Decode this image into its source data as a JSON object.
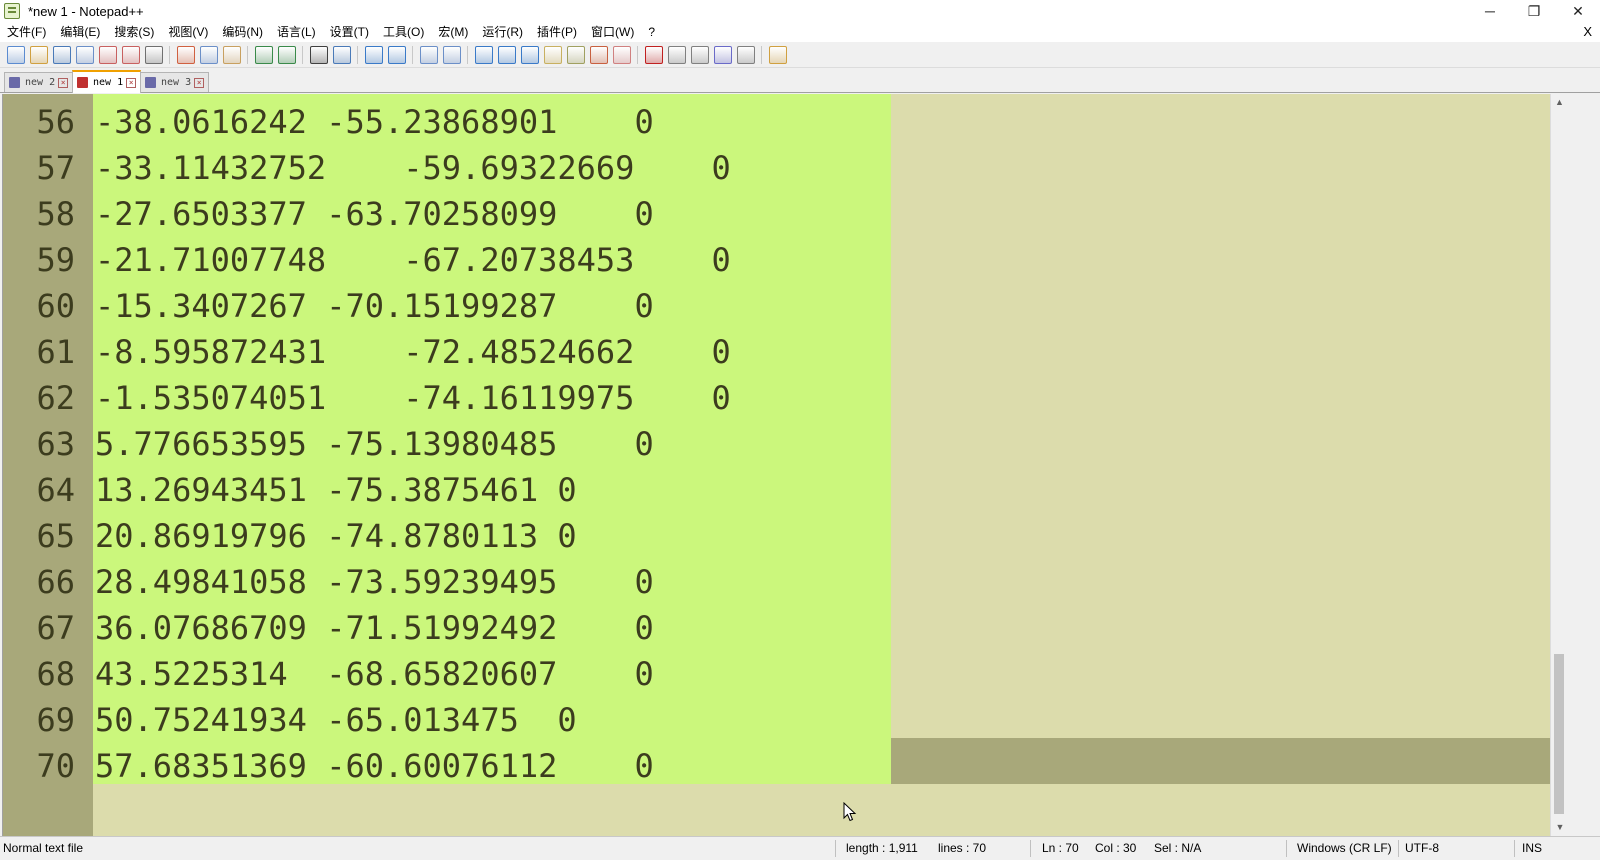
{
  "window": {
    "title": "*new 1 - Notepad++",
    "minimize_glyph": "─",
    "restore_glyph": "❐",
    "close_glyph": "✕"
  },
  "menu": {
    "items": [
      "文件(F)",
      "编辑(E)",
      "搜索(S)",
      "视图(V)",
      "编码(N)",
      "语言(L)",
      "设置(T)",
      "工具(O)",
      "宏(M)",
      "运行(R)",
      "插件(P)",
      "窗口(W)",
      "?"
    ],
    "close_label": "X"
  },
  "toolbar": {
    "icons": [
      "new-file-icon",
      "open-file-icon",
      "save-icon",
      "save-all-icon",
      "close-icon",
      "close-all-icon",
      "print-icon",
      "cut-icon",
      "copy-icon",
      "paste-icon",
      "undo-icon",
      "redo-icon",
      "find-icon",
      "replace-icon",
      "zoom-in-icon",
      "zoom-out-icon",
      "sync-vertical-icon",
      "sync-horizontal-icon",
      "word-wrap-icon",
      "show-all-chars-icon",
      "indent-guide-icon",
      "document-map-icon",
      "function-list-icon",
      "folder-workspace-icon",
      "monitoring-icon",
      "macro-record-icon",
      "macro-stop-icon",
      "macro-play-icon",
      "macro-run-multiple-icon",
      "macro-save-icon",
      "plugin-icon"
    ]
  },
  "tabs": [
    {
      "label": "new 2",
      "active": false,
      "color": "#6a6aa8"
    },
    {
      "label": "new 1",
      "active": true,
      "color": "#c03030"
    },
    {
      "label": "new 3",
      "active": false,
      "color": "#6a6aa8"
    }
  ],
  "editor": {
    "lines": [
      {
        "num": "56",
        "text": "-38.0616242 -55.23868901    0"
      },
      {
        "num": "57",
        "text": "-33.11432752    -59.69322669    0"
      },
      {
        "num": "58",
        "text": "-27.6503377 -63.70258099    0"
      },
      {
        "num": "59",
        "text": "-21.71007748    -67.20738453    0"
      },
      {
        "num": "60",
        "text": "-15.3407267 -70.15199287    0"
      },
      {
        "num": "61",
        "text": "-8.595872431    -72.48524662    0"
      },
      {
        "num": "62",
        "text": "-1.535074051    -74.16119975    0"
      },
      {
        "num": "63",
        "text": "5.776653595 -75.13980485    0"
      },
      {
        "num": "64",
        "text": "13.26943451 -75.3875461 0"
      },
      {
        "num": "65",
        "text": "20.86919796 -74.8780113 0"
      },
      {
        "num": "66",
        "text": "28.49841058 -73.59239495    0"
      },
      {
        "num": "67",
        "text": "36.07686709 -71.51992492    0"
      },
      {
        "num": "68",
        "text": "43.5225314  -68.65820607    0"
      },
      {
        "num": "69",
        "text": "50.75241934 -65.013475  0"
      },
      {
        "num": "70",
        "text": "57.68351369 -60.60076112    0"
      }
    ],
    "colors": {
      "background": "#dcdcac",
      "selection": "#cbf77c",
      "gutter": "#a8a87a",
      "text": "#3c3c1e"
    }
  },
  "scrollbar": {
    "up_glyph": "▲",
    "down_glyph": "▼"
  },
  "status": {
    "file_type": "Normal text file",
    "length": "length : 1,911",
    "lines": "lines : 70",
    "ln": "Ln : 70",
    "col": "Col : 30",
    "sel": "Sel : N/A",
    "eol": "Windows (CR LF)",
    "encoding": "UTF-8",
    "mode": "INS"
  }
}
